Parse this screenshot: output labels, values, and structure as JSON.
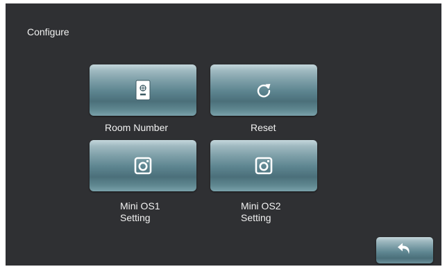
{
  "screen": {
    "title": "Configure"
  },
  "tiles": [
    {
      "label": "Room Number",
      "icon": "room-number-icon"
    },
    {
      "label": "Reset",
      "icon": "reset-icon"
    },
    {
      "label_line1": "Mini OS1",
      "label_line2": "Setting",
      "icon": "camera-icon"
    },
    {
      "label_line1": "Mini OS2",
      "label_line2": "Setting",
      "icon": "camera-icon"
    }
  ],
  "footer": {
    "back_icon": "back-arrow-icon"
  },
  "colors": {
    "background": "#2f3033",
    "tile_mid": "#5d8590",
    "text": "#f2f2f2"
  }
}
